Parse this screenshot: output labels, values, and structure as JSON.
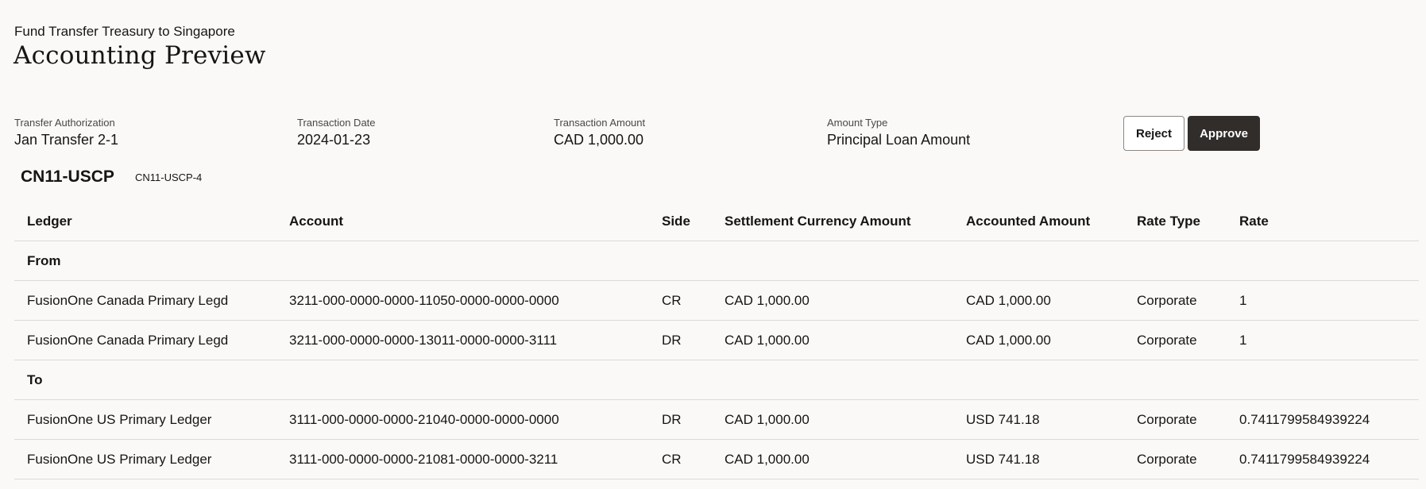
{
  "header": {
    "subtitle": "Fund Transfer Treasury to Singapore",
    "title": "Accounting Preview"
  },
  "fields": [
    {
      "label": "Transfer Authorization",
      "value": "Jan Transfer 2-1"
    },
    {
      "label": "Transaction Date",
      "value": "2024-01-23"
    },
    {
      "label": "Transaction Amount",
      "value": "CAD 1,000.00"
    },
    {
      "label": "Amount Type",
      "value": "Principal Loan Amount"
    }
  ],
  "actions": {
    "reject_label": "Reject",
    "approve_label": "Approve"
  },
  "entity": {
    "code": "CN11-USCP",
    "sub_code": "CN11-USCP-4"
  },
  "table": {
    "columns": [
      "Ledger",
      "Account",
      "Side",
      "Settlement Currency Amount",
      "Accounted Amount",
      "Rate Type",
      "Rate"
    ],
    "groups": [
      {
        "label": "From",
        "rows": [
          [
            "FusionOne Canada Primary Legd",
            "3211-000-0000-0000-11050-0000-0000-0000",
            "CR",
            "CAD 1,000.00",
            "CAD 1,000.00",
            "Corporate",
            "1"
          ],
          [
            "FusionOne Canada Primary Legd",
            "3211-000-0000-0000-13011-0000-0000-3111",
            "DR",
            "CAD 1,000.00",
            "CAD 1,000.00",
            "Corporate",
            "1"
          ]
        ]
      },
      {
        "label": "To",
        "rows": [
          [
            "FusionOne US Primary Ledger",
            "3111-000-0000-0000-21040-0000-0000-0000",
            "DR",
            "CAD 1,000.00",
            "USD 741.18",
            "Corporate",
            "0.7411799584939224"
          ],
          [
            "FusionOne US Primary Ledger",
            "3111-000-0000-0000-21081-0000-0000-3211",
            "CR",
            "CAD 1,000.00",
            "USD 741.18",
            "Corporate",
            "0.7411799584939224"
          ]
        ]
      }
    ]
  }
}
